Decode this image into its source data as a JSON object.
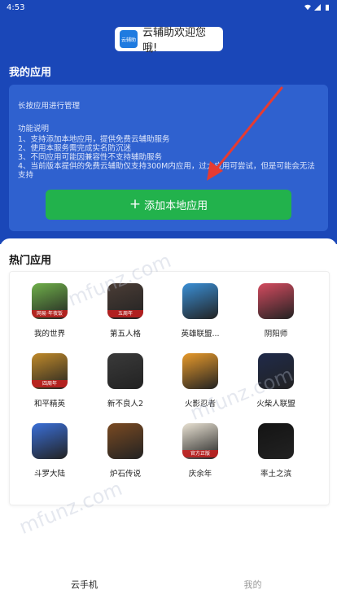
{
  "status": {
    "time": "4:53"
  },
  "header": {
    "welcome": "云辅助欢迎您哦!",
    "logo_text": "云辅助"
  },
  "my_apps": {
    "title": "我的应用",
    "hint": "长按应用进行管理",
    "features_title": "功能说明",
    "features": [
      "1、支持添加本地应用，提供免费云辅助服务",
      "2、使用本服务需完成实名防沉迷",
      "3、不同应用可能因兼容性不支持辅助服务",
      "4、当前版本提供的免费云辅助仅支持300M内应用，过大应用可尝试，但是可能会无法支持"
    ],
    "add_button": "添加本地应用"
  },
  "hot": {
    "title": "热门应用",
    "apps": [
      {
        "name": "我的世界",
        "badge": "网易·年夜饭",
        "color": "#6fb04a"
      },
      {
        "name": "第五人格",
        "badge": "五周年",
        "color": "#4b3d36"
      },
      {
        "name": "英雄联盟...",
        "color": "#3a8fd6"
      },
      {
        "name": "阴阳师",
        "color": "#d44b5f"
      },
      {
        "name": "和平精英",
        "badge": "四周年",
        "color": "#c08a2a"
      },
      {
        "name": "新不良人2",
        "color": "#3a3a3a"
      },
      {
        "name": "火影忍者",
        "color": "#e89a2b"
      },
      {
        "name": "火柴人联盟",
        "color": "#1f2a4a"
      },
      {
        "name": "斗罗大陆",
        "color": "#3a6fd8"
      },
      {
        "name": "炉石传说",
        "color": "#7a4a22"
      },
      {
        "name": "庆余年",
        "badge": "官方正版",
        "color": "#e9e2d3"
      },
      {
        "name": "率土之滨",
        "color": "#141414"
      }
    ]
  },
  "tabs": {
    "cloud": "云手机",
    "mine": "我的"
  },
  "watermark": "mfunz.com",
  "colors": {
    "primary": "#1a47b8",
    "card": "#2f61cf",
    "button": "#22b24c"
  }
}
